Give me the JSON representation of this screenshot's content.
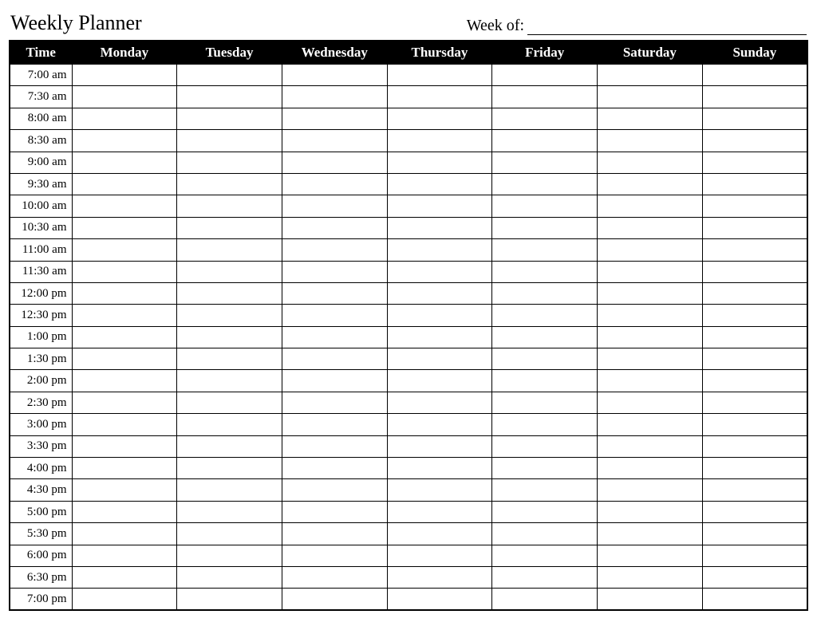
{
  "header": {
    "title": "Weekly Planner",
    "week_of_label": "Week of:",
    "week_of_value": ""
  },
  "columns": {
    "time": "Time",
    "days": [
      "Monday",
      "Tuesday",
      "Wednesday",
      "Thursday",
      "Friday",
      "Saturday",
      "Sunday"
    ]
  },
  "rows": [
    {
      "time": "7:00 am",
      "cells": [
        "",
        "",
        "",
        "",
        "",
        "",
        ""
      ]
    },
    {
      "time": "7:30 am",
      "cells": [
        "",
        "",
        "",
        "",
        "",
        "",
        ""
      ]
    },
    {
      "time": "8:00 am",
      "cells": [
        "",
        "",
        "",
        "",
        "",
        "",
        ""
      ]
    },
    {
      "time": "8:30 am",
      "cells": [
        "",
        "",
        "",
        "",
        "",
        "",
        ""
      ]
    },
    {
      "time": "9:00 am",
      "cells": [
        "",
        "",
        "",
        "",
        "",
        "",
        ""
      ]
    },
    {
      "time": "9:30 am",
      "cells": [
        "",
        "",
        "",
        "",
        "",
        "",
        ""
      ]
    },
    {
      "time": "10:00 am",
      "cells": [
        "",
        "",
        "",
        "",
        "",
        "",
        ""
      ]
    },
    {
      "time": "10:30 am",
      "cells": [
        "",
        "",
        "",
        "",
        "",
        "",
        ""
      ]
    },
    {
      "time": "11:00 am",
      "cells": [
        "",
        "",
        "",
        "",
        "",
        "",
        ""
      ]
    },
    {
      "time": "11:30 am",
      "cells": [
        "",
        "",
        "",
        "",
        "",
        "",
        ""
      ]
    },
    {
      "time": "12:00 pm",
      "cells": [
        "",
        "",
        "",
        "",
        "",
        "",
        ""
      ]
    },
    {
      "time": "12:30 pm",
      "cells": [
        "",
        "",
        "",
        "",
        "",
        "",
        ""
      ]
    },
    {
      "time": "1:00 pm",
      "cells": [
        "",
        "",
        "",
        "",
        "",
        "",
        ""
      ]
    },
    {
      "time": "1:30 pm",
      "cells": [
        "",
        "",
        "",
        "",
        "",
        "",
        ""
      ]
    },
    {
      "time": "2:00 pm",
      "cells": [
        "",
        "",
        "",
        "",
        "",
        "",
        ""
      ]
    },
    {
      "time": "2:30 pm",
      "cells": [
        "",
        "",
        "",
        "",
        "",
        "",
        ""
      ]
    },
    {
      "time": "3:00 pm",
      "cells": [
        "",
        "",
        "",
        "",
        "",
        "",
        ""
      ]
    },
    {
      "time": "3:30 pm",
      "cells": [
        "",
        "",
        "",
        "",
        "",
        "",
        ""
      ]
    },
    {
      "time": "4:00 pm",
      "cells": [
        "",
        "",
        "",
        "",
        "",
        "",
        ""
      ]
    },
    {
      "time": "4:30 pm",
      "cells": [
        "",
        "",
        "",
        "",
        "",
        "",
        ""
      ]
    },
    {
      "time": "5:00 pm",
      "cells": [
        "",
        "",
        "",
        "",
        "",
        "",
        ""
      ]
    },
    {
      "time": "5:30 pm",
      "cells": [
        "",
        "",
        "",
        "",
        "",
        "",
        ""
      ]
    },
    {
      "time": "6:00 pm",
      "cells": [
        "",
        "",
        "",
        "",
        "",
        "",
        ""
      ]
    },
    {
      "time": "6:30 pm",
      "cells": [
        "",
        "",
        "",
        "",
        "",
        "",
        ""
      ]
    },
    {
      "time": "7:00 pm",
      "cells": [
        "",
        "",
        "",
        "",
        "",
        "",
        ""
      ]
    }
  ]
}
